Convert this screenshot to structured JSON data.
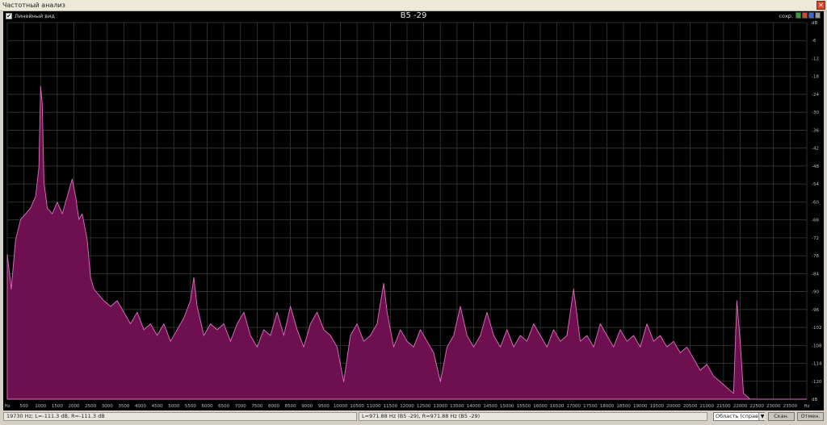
{
  "window": {
    "title": "Частотный анализ",
    "close_glyph": "✕"
  },
  "header": {
    "checkbox_label": "Линейный вид",
    "checkbox_checked": true,
    "chart_title": "B5 -29",
    "save_label": "сохр.",
    "buttons": [
      "green",
      "red",
      "blue",
      "grey"
    ]
  },
  "chart_data": {
    "type": "area",
    "title": "B5 -29",
    "x_unit": "Hz",
    "y_unit": "dB",
    "xlim": [
      0,
      24000
    ],
    "ylim": [
      -130,
      0
    ],
    "grid": true,
    "x_ticks": [
      "Hz",
      "500",
      "1000",
      "1500",
      "2000",
      "2500",
      "3000",
      "3500",
      "4000",
      "4500",
      "5000",
      "5500",
      "6000",
      "6500",
      "7000",
      "7500",
      "8000",
      "8500",
      "9000",
      "9500",
      "10000",
      "10500",
      "11000",
      "11500",
      "12000",
      "12500",
      "13000",
      "13500",
      "14000",
      "14500",
      "15000",
      "15500",
      "16000",
      "16500",
      "17000",
      "17500",
      "18000",
      "18500",
      "19000",
      "19500",
      "20000",
      "20500",
      "21000",
      "21500",
      "22000",
      "22500",
      "23000",
      "23500",
      "Hz"
    ],
    "y_ticks": [
      "dB",
      "-6",
      "-12",
      "-18",
      "-24",
      "-30",
      "-36",
      "-42",
      "-48",
      "-54",
      "-60",
      "-66",
      "-72",
      "-78",
      "-84",
      "-90",
      "-96",
      "-102",
      "-108",
      "-114",
      "-120",
      "dB"
    ],
    "series": [
      {
        "color": "#6e1050",
        "line_color": "#e070c0",
        "points": [
          [
            0,
            -80
          ],
          [
            120,
            -92
          ],
          [
            250,
            -75
          ],
          [
            400,
            -68
          ],
          [
            550,
            -66
          ],
          [
            700,
            -64
          ],
          [
            850,
            -60
          ],
          [
            950,
            -50
          ],
          [
            1000,
            -22
          ],
          [
            1050,
            -28
          ],
          [
            1100,
            -55
          ],
          [
            1200,
            -64
          ],
          [
            1350,
            -66
          ],
          [
            1500,
            -62
          ],
          [
            1650,
            -66
          ],
          [
            1800,
            -60
          ],
          [
            1950,
            -54
          ],
          [
            2050,
            -60
          ],
          [
            2150,
            -68
          ],
          [
            2250,
            -66
          ],
          [
            2400,
            -75
          ],
          [
            2500,
            -88
          ],
          [
            2600,
            -92
          ],
          [
            2750,
            -94
          ],
          [
            2900,
            -96
          ],
          [
            3100,
            -98
          ],
          [
            3300,
            -96
          ],
          [
            3500,
            -100
          ],
          [
            3700,
            -104
          ],
          [
            3900,
            -100
          ],
          [
            4100,
            -106
          ],
          [
            4300,
            -104
          ],
          [
            4500,
            -108
          ],
          [
            4700,
            -104
          ],
          [
            4900,
            -110
          ],
          [
            5100,
            -106
          ],
          [
            5300,
            -102
          ],
          [
            5500,
            -96
          ],
          [
            5600,
            -88
          ],
          [
            5700,
            -98
          ],
          [
            5900,
            -108
          ],
          [
            6100,
            -104
          ],
          [
            6300,
            -106
          ],
          [
            6500,
            -104
          ],
          [
            6700,
            -110
          ],
          [
            6900,
            -104
          ],
          [
            7100,
            -100
          ],
          [
            7300,
            -108
          ],
          [
            7500,
            -112
          ],
          [
            7700,
            -106
          ],
          [
            7900,
            -108
          ],
          [
            8100,
            -100
          ],
          [
            8300,
            -108
          ],
          [
            8500,
            -98
          ],
          [
            8700,
            -106
          ],
          [
            8900,
            -112
          ],
          [
            9100,
            -104
          ],
          [
            9300,
            -100
          ],
          [
            9500,
            -106
          ],
          [
            9700,
            -108
          ],
          [
            9900,
            -112
          ],
          [
            10100,
            -124
          ],
          [
            10300,
            -108
          ],
          [
            10500,
            -104
          ],
          [
            10700,
            -110
          ],
          [
            10900,
            -108
          ],
          [
            11100,
            -104
          ],
          [
            11300,
            -90
          ],
          [
            11400,
            -100
          ],
          [
            11600,
            -112
          ],
          [
            11800,
            -106
          ],
          [
            12000,
            -110
          ],
          [
            12200,
            -112
          ],
          [
            12400,
            -106
          ],
          [
            12600,
            -110
          ],
          [
            12800,
            -114
          ],
          [
            13000,
            -124
          ],
          [
            13200,
            -112
          ],
          [
            13400,
            -108
          ],
          [
            13600,
            -98
          ],
          [
            13800,
            -108
          ],
          [
            14000,
            -112
          ],
          [
            14200,
            -108
          ],
          [
            14400,
            -100
          ],
          [
            14600,
            -108
          ],
          [
            14800,
            -112
          ],
          [
            15000,
            -106
          ],
          [
            15200,
            -112
          ],
          [
            15400,
            -108
          ],
          [
            15600,
            -110
          ],
          [
            15800,
            -104
          ],
          [
            16000,
            -108
          ],
          [
            16200,
            -112
          ],
          [
            16400,
            -106
          ],
          [
            16600,
            -110
          ],
          [
            16800,
            -108
          ],
          [
            17000,
            -92
          ],
          [
            17200,
            -110
          ],
          [
            17400,
            -108
          ],
          [
            17600,
            -112
          ],
          [
            17800,
            -104
          ],
          [
            18000,
            -108
          ],
          [
            18200,
            -112
          ],
          [
            18400,
            -106
          ],
          [
            18600,
            -110
          ],
          [
            18800,
            -108
          ],
          [
            19000,
            -112
          ],
          [
            19200,
            -104
          ],
          [
            19400,
            -110
          ],
          [
            19600,
            -108
          ],
          [
            19800,
            -112
          ],
          [
            20000,
            -110
          ],
          [
            20200,
            -114
          ],
          [
            20400,
            -112
          ],
          [
            20600,
            -116
          ],
          [
            20800,
            -120
          ],
          [
            21000,
            -118
          ],
          [
            21200,
            -122
          ],
          [
            21400,
            -124
          ],
          [
            21600,
            -126
          ],
          [
            21800,
            -128
          ],
          [
            21900,
            -96
          ],
          [
            22000,
            -110
          ],
          [
            22100,
            -128
          ],
          [
            22300,
            -130
          ],
          [
            23000,
            -130
          ],
          [
            24000,
            -130
          ]
        ]
      }
    ]
  },
  "status": {
    "cursor_readout": "19730 Hz; L=-111.3 dB, R=-111.3 dB",
    "peak_readout": "L=971.88 Hz (B5 -29), R=971.88 Hz (B5 -29)",
    "region_select": "Область (справа о",
    "scan_button": "Скан.",
    "close_button": "Отмен."
  }
}
